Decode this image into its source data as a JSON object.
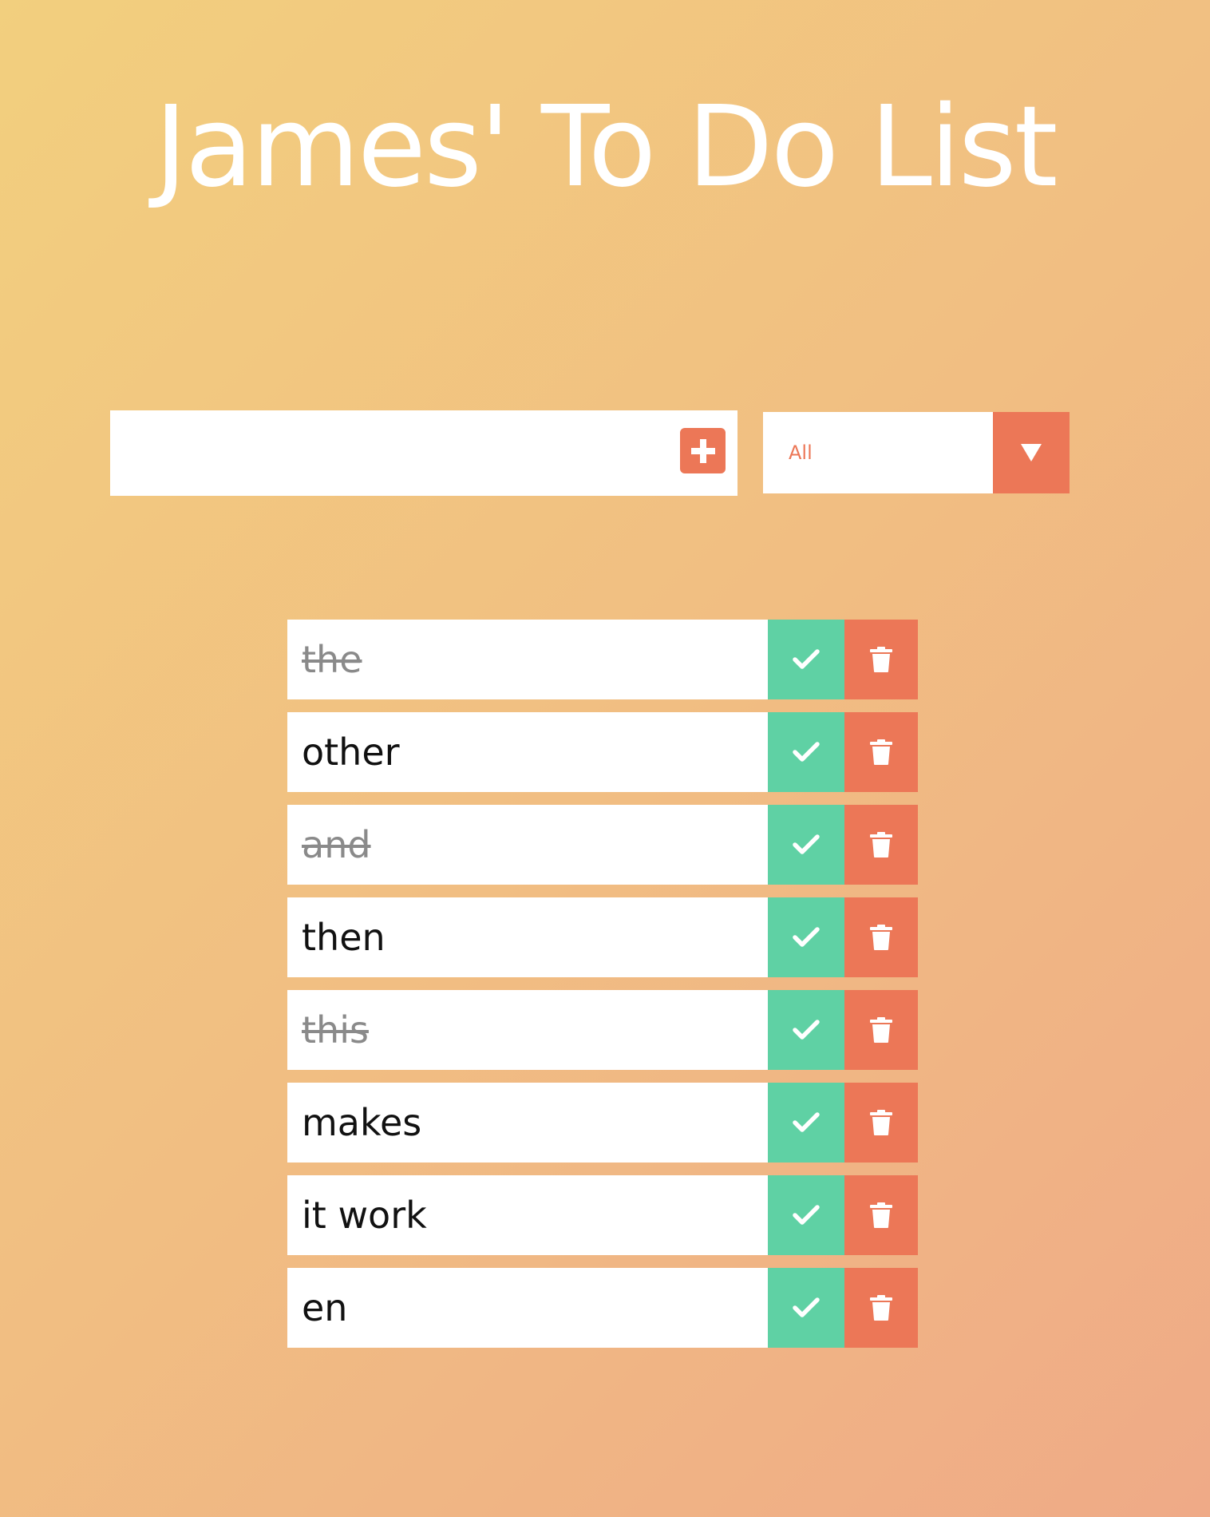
{
  "header": {
    "title": "James' To Do List"
  },
  "form": {
    "input_value": "",
    "add_icon": "plus-icon",
    "filter": {
      "selected": "All",
      "icon": "triangle-down-icon"
    }
  },
  "todos": [
    {
      "text": "the",
      "completed": true
    },
    {
      "text": "other",
      "completed": false
    },
    {
      "text": "and",
      "completed": true
    },
    {
      "text": "then",
      "completed": false
    },
    {
      "text": "this",
      "completed": true
    },
    {
      "text": "makes",
      "completed": false
    },
    {
      "text": "it work",
      "completed": false
    },
    {
      "text": "en",
      "completed": false
    }
  ],
  "icons": {
    "complete": "check-icon",
    "delete": "trash-icon"
  },
  "colors": {
    "accent": "#ec7757",
    "complete": "#5fd1a4",
    "title": "#ffffff",
    "done_text": "#8a8a8a"
  }
}
